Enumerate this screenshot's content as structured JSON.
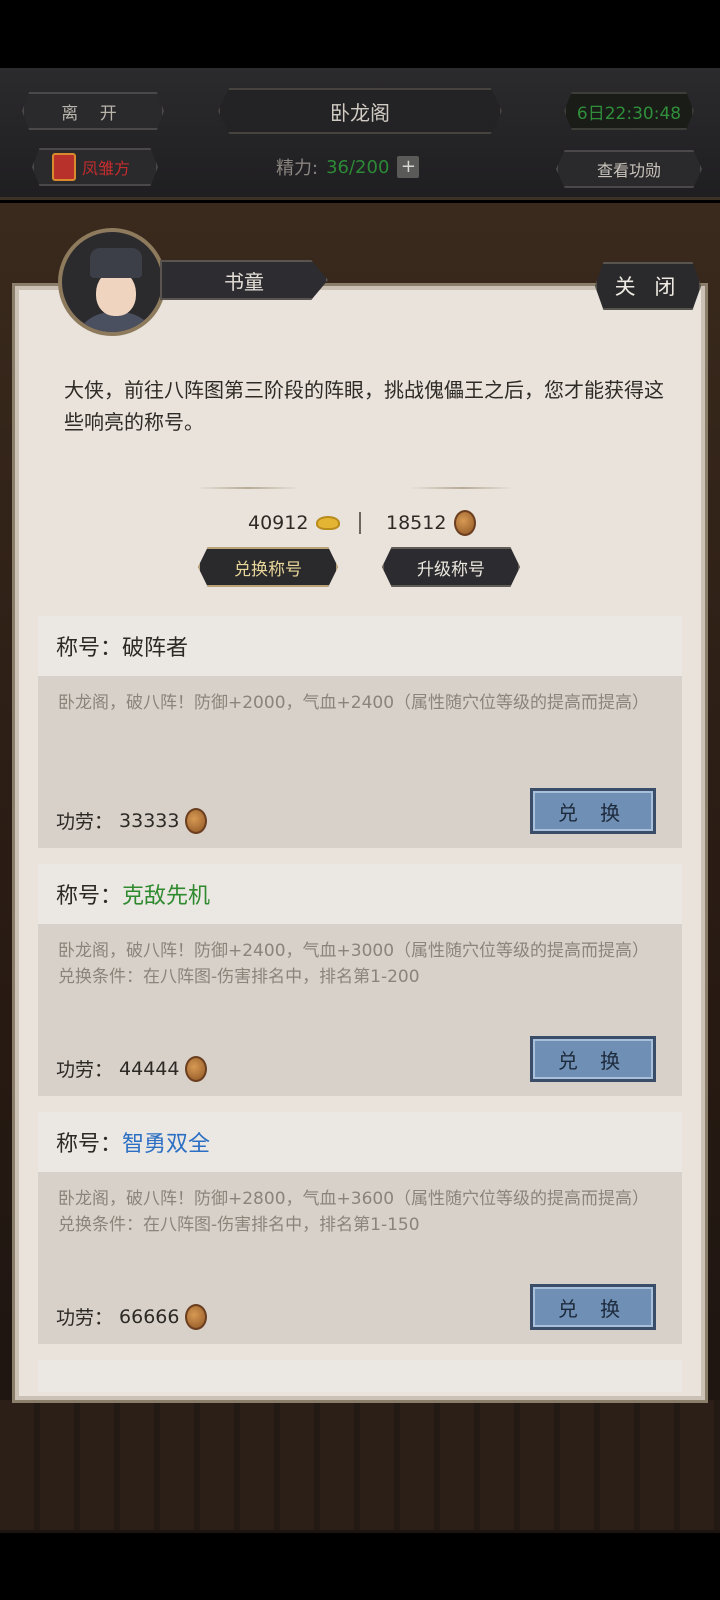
{
  "topbar": {
    "leave_label": "离 开",
    "location_title": "卧龙阁",
    "timer": "6日22:30:48",
    "character_name": "凤雏方",
    "energy_label": "精力:",
    "energy_value": "36/200",
    "view_merit_label": "查看功勋"
  },
  "dialog": {
    "speaker": "书童",
    "close_label": "关 闭",
    "message": "大侠，前往八阵图第三阶段的阵眼，挑战傀儡王之后，您才能获得这些响亮的称号。",
    "gold_amount": "40912",
    "merit_amount": "18512",
    "tabs": [
      "兑换称号",
      "升级称号"
    ]
  },
  "titles": [
    {
      "prefix": "称号：",
      "name": "破阵者",
      "name_color": "#2d2924",
      "desc": "卧龙阁，破八阵！防御+2000，气血+2400（属性随穴位等级的提高而提高）",
      "condition": "",
      "cost_label": "功劳：",
      "cost": "33333",
      "button": "兑 换"
    },
    {
      "prefix": "称号：",
      "name": "克敌先机",
      "name_color": "#2f8a2f",
      "desc": "卧龙阁，破八阵！防御+2400，气血+3000（属性随穴位等级的提高而提高）",
      "condition": "兑换条件：在八阵图-伤害排名中，排名第1-200",
      "cost_label": "功劳：",
      "cost": "44444",
      "button": "兑 换"
    },
    {
      "prefix": "称号：",
      "name": "智勇双全",
      "name_color": "#2b6fc4",
      "desc": "卧龙阁，破八阵！防御+2800，气血+3600（属性随穴位等级的提高而提高）",
      "condition": "兑换条件：在八阵图-伤害排名中，排名第1-150",
      "cost_label": "功劳：",
      "cost": "66666",
      "button": "兑 换"
    }
  ]
}
